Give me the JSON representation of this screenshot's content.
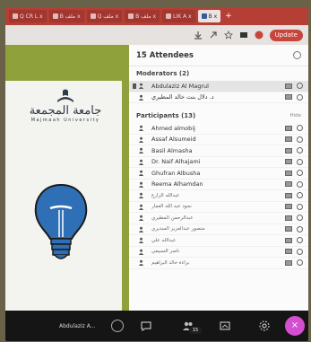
{
  "browser": {
    "tabs": [
      {
        "label": "Q CR L x"
      },
      {
        "label": "B ملف x"
      },
      {
        "label": "Q ملف x"
      },
      {
        "label": "B ملف x"
      },
      {
        "label": "LIK A x"
      },
      {
        "label": "B x",
        "active": true
      }
    ],
    "new_tab": "+",
    "update_label": "Update"
  },
  "presentation": {
    "university_name": "جامعة المجمعة",
    "university_latin": "Majmaah University"
  },
  "panel": {
    "title": "15 Attendees",
    "moderators_heading": "Moderators (2)",
    "moderators": [
      {
        "name": "Abdulaziz Al Magrul"
      },
      {
        "name": "د. دلال بنت خالد المطيري"
      }
    ],
    "participants_heading": "Participants (13)",
    "hide_label": "Hide",
    "participants": [
      {
        "name": "Ahmed almobij"
      },
      {
        "name": "Assaf Alsumeid"
      },
      {
        "name": "Basil Almasha"
      },
      {
        "name": "Dr. Naif Alhajami"
      },
      {
        "name": "Ghufran Albusha"
      },
      {
        "name": "Reema Alhamdan"
      },
      {
        "name": "عبدالله الزارع"
      },
      {
        "name": "نجود عبد الله العمار"
      },
      {
        "name": "عبدالرحمن المطيري"
      },
      {
        "name": "منصور عبدالعزيز السديري"
      },
      {
        "name": "عبدالله علي"
      },
      {
        "name": "ناصر السبيعي"
      },
      {
        "name": "براءة خالد البراهيم"
      }
    ]
  },
  "bottombar": {
    "presenter_label": "Abdulaziz A...",
    "attendee_badge": "15",
    "fab_label": "×"
  },
  "colors": {
    "tab_bar": "#b53e35",
    "accent_pink": "#d34ed0",
    "slide_green": "#8fa13a"
  }
}
